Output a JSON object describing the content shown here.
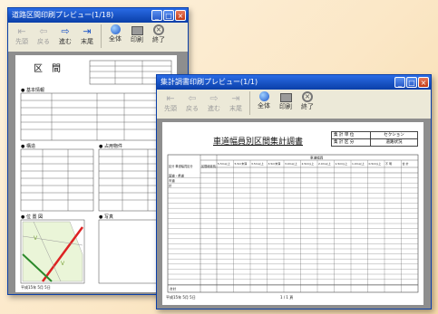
{
  "back_window": {
    "title": "道路区間印刷プレビュー(1/18)",
    "toolbar": [
      {
        "label": "先頭",
        "icon": "first-page-icon",
        "enabled": false
      },
      {
        "label": "戻る",
        "icon": "prev-page-icon",
        "enabled": false
      },
      {
        "label": "進む",
        "icon": "next-page-icon",
        "enabled": true
      },
      {
        "label": "末尾",
        "icon": "last-page-icon",
        "enabled": true
      },
      {
        "label": "全体",
        "icon": "fit-page-icon",
        "enabled": true
      },
      {
        "label": "印刷",
        "icon": "printer-icon",
        "enabled": true
      },
      {
        "label": "終了",
        "icon": "exit-icon",
        "enabled": true
      }
    ],
    "doc": {
      "heading": "区　間",
      "section_basic": "● 基本情報",
      "section_survey": "● 構造",
      "section_cross": "● 占用物件",
      "section_map": "● 位 置 図",
      "section_photo": "● 写真",
      "footer_date": "平成15年 5月 5日"
    }
  },
  "front_window": {
    "title": "集計調書印刷プレビュー(1/1)",
    "toolbar": [
      {
        "label": "先頭",
        "icon": "first-page-icon",
        "enabled": false
      },
      {
        "label": "戻る",
        "icon": "prev-page-icon",
        "enabled": false
      },
      {
        "label": "進む",
        "icon": "next-page-icon",
        "enabled": false
      },
      {
        "label": "末尾",
        "icon": "last-page-icon",
        "enabled": false
      },
      {
        "label": "全体",
        "icon": "fit-page-icon",
        "enabled": true
      },
      {
        "label": "印刷",
        "icon": "printer-icon",
        "enabled": true
      },
      {
        "label": "終了",
        "icon": "exit-icon",
        "enabled": true
      }
    ],
    "doc": {
      "title": "車道幅員別区間集計調書",
      "meta": [
        {
          "k": "集 計 単 位",
          "v": "セクション"
        },
        {
          "k": "集 計 区 分",
          "v": "道路状況"
        }
      ],
      "group_header": "車道幅員",
      "col_first": "区分  車道幅員区分",
      "col_second": "区間総延長",
      "columns": [
        "5.5m以上",
        "5.5m未満",
        "3.5m以上",
        "3.5m未満",
        "3.0m以上",
        "2.5m以上",
        "2.0m以上",
        "1.5m以上",
        "1.0m以上",
        "0.5m以上",
        "不 明",
        "合 計"
      ],
      "rows": [
        {
          "label": "国道・県道",
          "values": [
            "",
            "",
            "",
            "",
            "",
            "",
            "",
            "",
            "",
            "",
            "",
            ""
          ]
        },
        {
          "label": "市道",
          "values": [
            "",
            "",
            "",
            "",
            "",
            "",
            "",
            "",
            "",
            "",
            "",
            ""
          ]
        },
        {
          "label": "計",
          "values": [
            "",
            "",
            "",
            "",
            "",
            "",
            "",
            "",
            "",
            "",
            "",
            ""
          ]
        }
      ],
      "total_label": "合計",
      "footer_date": "平成15年 5月 5日",
      "page": "1 / 1 頁"
    }
  }
}
